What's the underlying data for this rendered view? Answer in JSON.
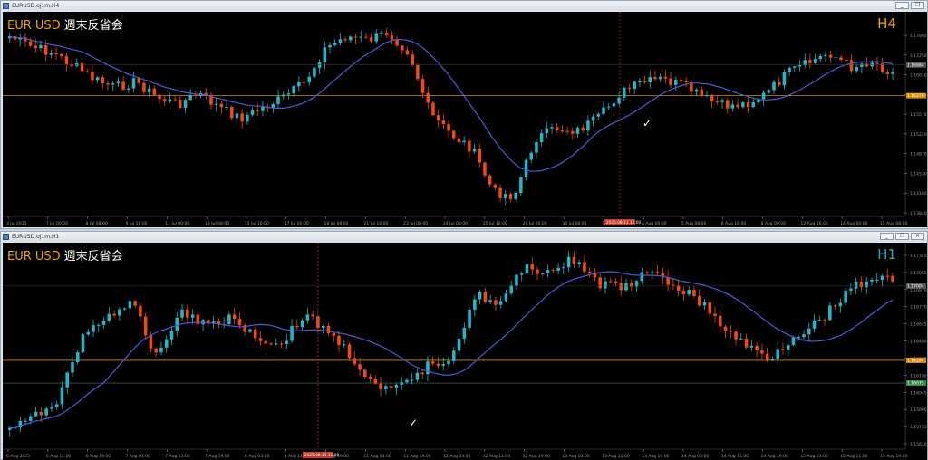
{
  "colors": {
    "bull": "#26b5c6",
    "bear": "#f04a0f",
    "ma": "#4a5ad8",
    "hline": "#d88c00",
    "grid_h": "#3a3a3a",
    "axis": "#9a9a9a",
    "tf_h4": "#e8a400",
    "tf_h1": "#2aa6b8",
    "label_bg": "#555555",
    "green_tag": "#2f8a3e",
    "red_tag": "#c0392b"
  },
  "top": {
    "window_title": "EURUSD.oj1m,H4",
    "symbol": "EUR USD",
    "note": "週末反省会",
    "timeframe": "H4",
    "price_axis": [
      "1.17890",
      "1.17250",
      "1.16610",
      "1.15970",
      "1.15570",
      "1.15220",
      "1.14870",
      "1.14530",
      "1.14180",
      "1.13840"
    ],
    "current_price": "1.16884",
    "hline_price": "1.16279",
    "time_axis": [
      "3 Jul 2025",
      "7 Jul 00:00",
      "8 Jul 08:00",
      "9 Jul 16:00",
      "11 Jul 00:00",
      "14 Jul 08:00",
      "15 Jul 16:00",
      "17 Jul 00:00",
      "18 Jul 08:00",
      "21 Jul 16:00",
      "23 Jul 00:00",
      "24 Jul 08:00",
      "25 Jul 16:00",
      "29 Jul 00:00",
      "30 Jul 08:00",
      "31 Jul 16:00",
      "4 Aug 00:00",
      "5 Aug 08:00",
      "6 Aug 16:00",
      "8 Aug 00:00",
      "12 Aug 16:00",
      "14 Aug 00:00",
      "15 Aug 08:00"
    ],
    "time_marker": "2025.08.11 12:00"
  },
  "bottom": {
    "window_title": "EURUSD.oj1m,H1",
    "symbol": "EUR USD",
    "note": "週末反省会",
    "timeframe": "H1",
    "price_axis": [
      "1.17345",
      "1.17055",
      "1.16970",
      "1.16770",
      "1.16625",
      "1.16480",
      "1.16335",
      "1.16190",
      "1.16045",
      "1.15900",
      "1.15755",
      "1.15610"
    ],
    "current_price": "1.17004",
    "hline_price": "1.16284",
    "green_price": "1.16075",
    "time_axis": [
      "6 Aug 2025",
      "6 Aug 11:00",
      "6 Aug 19:00",
      "7 Aug 03:00",
      "7 Aug 11:00",
      "7 Aug 19:00",
      "8 Aug 03:00",
      "8 Aug 11:00",
      "8 Aug 19:00",
      "11 Aug 03:00",
      "11 Aug 19:00",
      "12 Aug 03:00",
      "12 Aug 11:00",
      "12 Aug 19:00",
      "13 Aug 03:00",
      "13 Aug 11:00",
      "13 Aug 19:00",
      "14 Aug 03:00",
      "14 Aug 11:00",
      "14 Aug 19:00",
      "15 Aug 03:00",
      "15 Aug 11:00",
      "15 Aug 19:00"
    ],
    "time_marker": "2025.08.11 11:00"
  },
  "win_buttons": [
    "_",
    "❐",
    "✕"
  ]
}
